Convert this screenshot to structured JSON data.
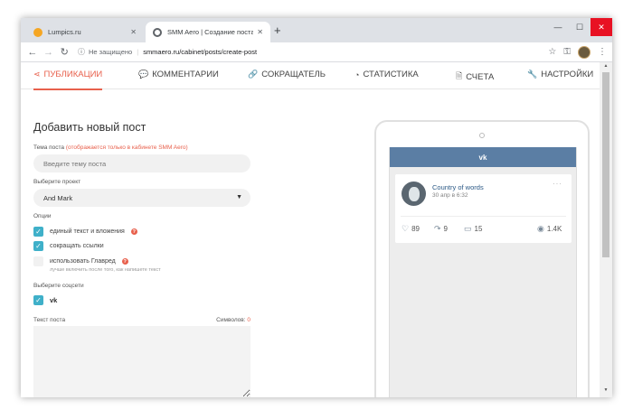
{
  "browser": {
    "tabs": [
      {
        "label": "Lumpics.ru",
        "favicon_color": "#f5a623"
      },
      {
        "label": "SMM Aero | Создание поста",
        "favicon_color": "#5f6368"
      }
    ],
    "new_tab": "+",
    "security_label": "Не защищено",
    "url": "smmaero.ru/cabinet/posts/create-post"
  },
  "nav": {
    "items": [
      {
        "label": "ПУБЛИКАЦИИ",
        "icon": "share-icon",
        "glyph": "⋖"
      },
      {
        "label": "КОММЕНТАРИИ",
        "icon": "comments-icon",
        "glyph": "💬"
      },
      {
        "label": "СОКРАЩАТЕЛЬ",
        "icon": "link-icon",
        "glyph": "🔗"
      },
      {
        "label": "СТАТИСТИКА",
        "icon": "pie-chart-icon",
        "glyph": "◔"
      },
      {
        "label": "СЧЕТА",
        "icon": "invoice-icon",
        "glyph": "🗎"
      },
      {
        "label": "НАСТРОЙКИ",
        "icon": "wrench-icon",
        "glyph": "🔧"
      }
    ],
    "accent": "#e8604c"
  },
  "form": {
    "title": "Добавить новый пост",
    "topic_label": "Тема поста",
    "topic_hint": "(отображается только в кабинете SMM Aero)",
    "topic_placeholder": "Введите тему поста",
    "project_label": "Выберите проект",
    "project_value": "And Mark",
    "options_label": "Опции",
    "options": [
      {
        "label": "единый текст и вложения",
        "checked": true,
        "help": true
      },
      {
        "label": "сокращать ссылки",
        "checked": true,
        "help": false
      },
      {
        "label": "использовать Главред",
        "checked": false,
        "help": true
      }
    ],
    "glavred_hint": "лучше включить после того, как напишете текст",
    "networks_label": "Выберите соцсети",
    "network_vk": "vk",
    "text_label": "Текст поста",
    "chars_label": "Символов:",
    "chars_count": "0",
    "check_color": "#3fb0c9"
  },
  "preview": {
    "bar_label": "vk",
    "bar_color": "#5b7ea4",
    "post_title": "Country of words",
    "post_date": "30 апр в 6:32",
    "more": "···",
    "likes": "89",
    "shares": "9",
    "comments": "15",
    "views": "1.4K"
  }
}
